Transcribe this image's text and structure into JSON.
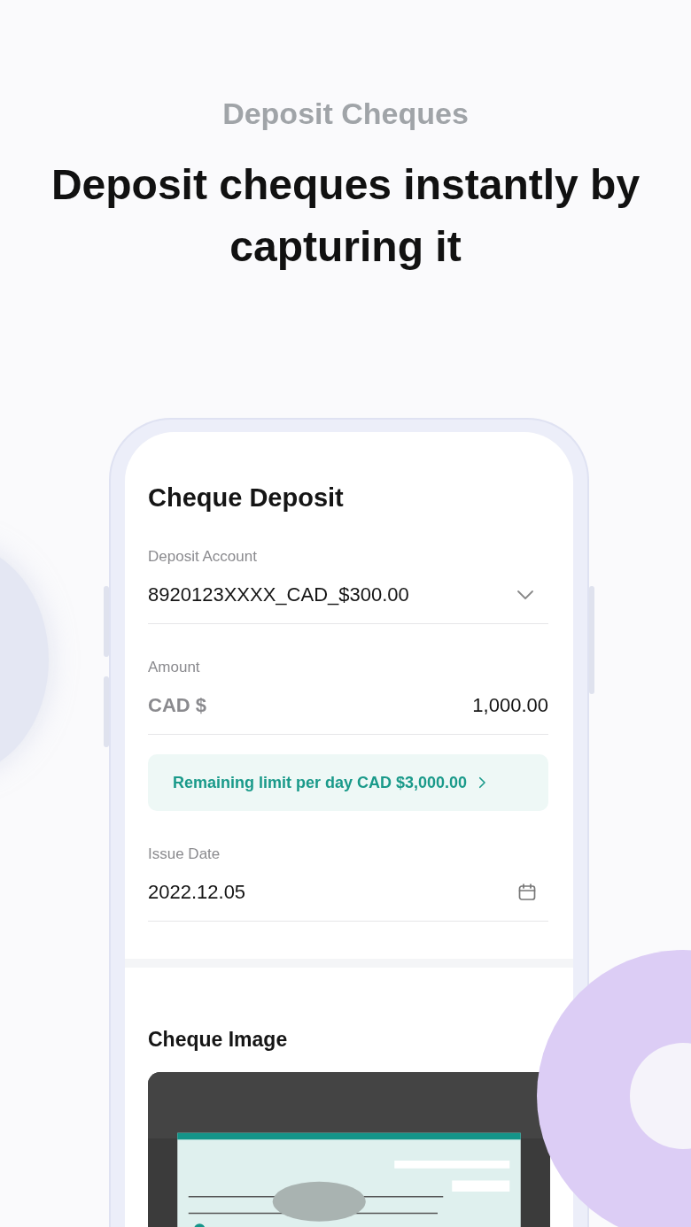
{
  "header": {
    "eyebrow": "Deposit Cheques",
    "title": "Deposit cheques instantly by capturing it"
  },
  "screen": {
    "title": "Cheque Deposit",
    "fields": [
      {
        "kind": "select",
        "label": "Deposit Account",
        "value": "8920123XXXX_CAD_$300.00"
      },
      {
        "kind": "amount",
        "label": "Amount",
        "prefix": "CAD $",
        "value": "1,000.00"
      },
      {
        "kind": "notice",
        "text": "Remaining limit per day CAD $3,000.00"
      },
      {
        "kind": "date",
        "label": "Issue Date",
        "value": "2022.12.05"
      }
    ],
    "image_section": {
      "title": "Cheque Image"
    }
  }
}
